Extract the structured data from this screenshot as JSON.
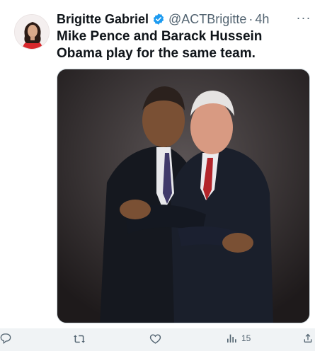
{
  "tweet": {
    "author_name": "Brigitte Gabriel",
    "handle": "@ACTBrigitte",
    "separator": "·",
    "time": "4h",
    "more_label": "···",
    "text": "Mike Pence and Barack Hussein Obama play for the same team."
  },
  "actions": {
    "views_count": "15"
  },
  "icons": {
    "verified": "verified-badge-icon",
    "reply": "reply-icon",
    "retweet": "retweet-icon",
    "like": "heart-icon",
    "views": "views-bar-chart-icon",
    "share": "share-icon"
  },
  "colors": {
    "verified_badge": "#1d9bf0",
    "text_primary": "#0f1419",
    "text_secondary": "#536471"
  }
}
